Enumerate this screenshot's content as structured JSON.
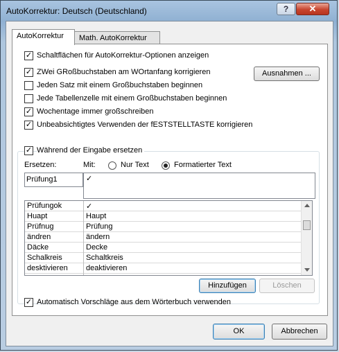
{
  "window": {
    "title": "AutoKorrektur: Deutsch (Deutschland)",
    "help_label": "?",
    "close_label": "✕"
  },
  "tabs": [
    {
      "label": "AutoKorrektur",
      "active": true
    },
    {
      "label": "Math. AutoKorrektur",
      "active": false
    }
  ],
  "options": {
    "show_buttons": {
      "label": "Schaltflächen für AutoKorrektur-Optionen anzeigen",
      "checked": true
    },
    "two_caps": {
      "label": "ZWei GRoßbuchstaben am WOrtanfang korrigieren",
      "checked": true
    },
    "sentence_caps": {
      "label": "Jeden Satz mit einem Großbuchstaben beginnen",
      "checked": false
    },
    "table_caps": {
      "label": "Jede Tabellenzelle mit einem Großbuchstaben beginnen",
      "checked": false
    },
    "weekdays": {
      "label": "Wochentage immer großschreiben",
      "checked": true
    },
    "capslock": {
      "label": "Unbeabsichtigtes Verwenden der fESTSTELLTASTE korrigieren",
      "checked": true
    }
  },
  "exceptions_button": "Ausnahmen ...",
  "replace_group": {
    "checkbox_label": "Während der Eingabe ersetzen",
    "checked": true,
    "replace_label": "Ersetzen:",
    "with_label": "Mit:",
    "radio_plain": "Nur Text",
    "radio_formatted": "Formatierter Text",
    "selected_radio": "formatted",
    "replace_value": "Prüfung1",
    "with_value": "✓"
  },
  "entries": [
    {
      "replace": "Prüfungok",
      "with": "✓"
    },
    {
      "replace": "Huapt",
      "with": "Haupt"
    },
    {
      "replace": "Prüfnug",
      "with": "Prüfung"
    },
    {
      "replace": "ändren",
      "with": "ändern"
    },
    {
      "replace": "Däcke",
      "with": "Decke"
    },
    {
      "replace": "Schalkreis",
      "with": "Schaltkreis"
    },
    {
      "replace": "desktivieren",
      "with": "deaktivieren"
    }
  ],
  "add_button": "Hinzufügen",
  "delete_button": "Löschen",
  "auto_suggest": {
    "label": "Automatisch Vorschläge aus dem Wörterbuch verwenden",
    "checked": true
  },
  "ok_button": "OK",
  "cancel_button": "Abbrechen"
}
